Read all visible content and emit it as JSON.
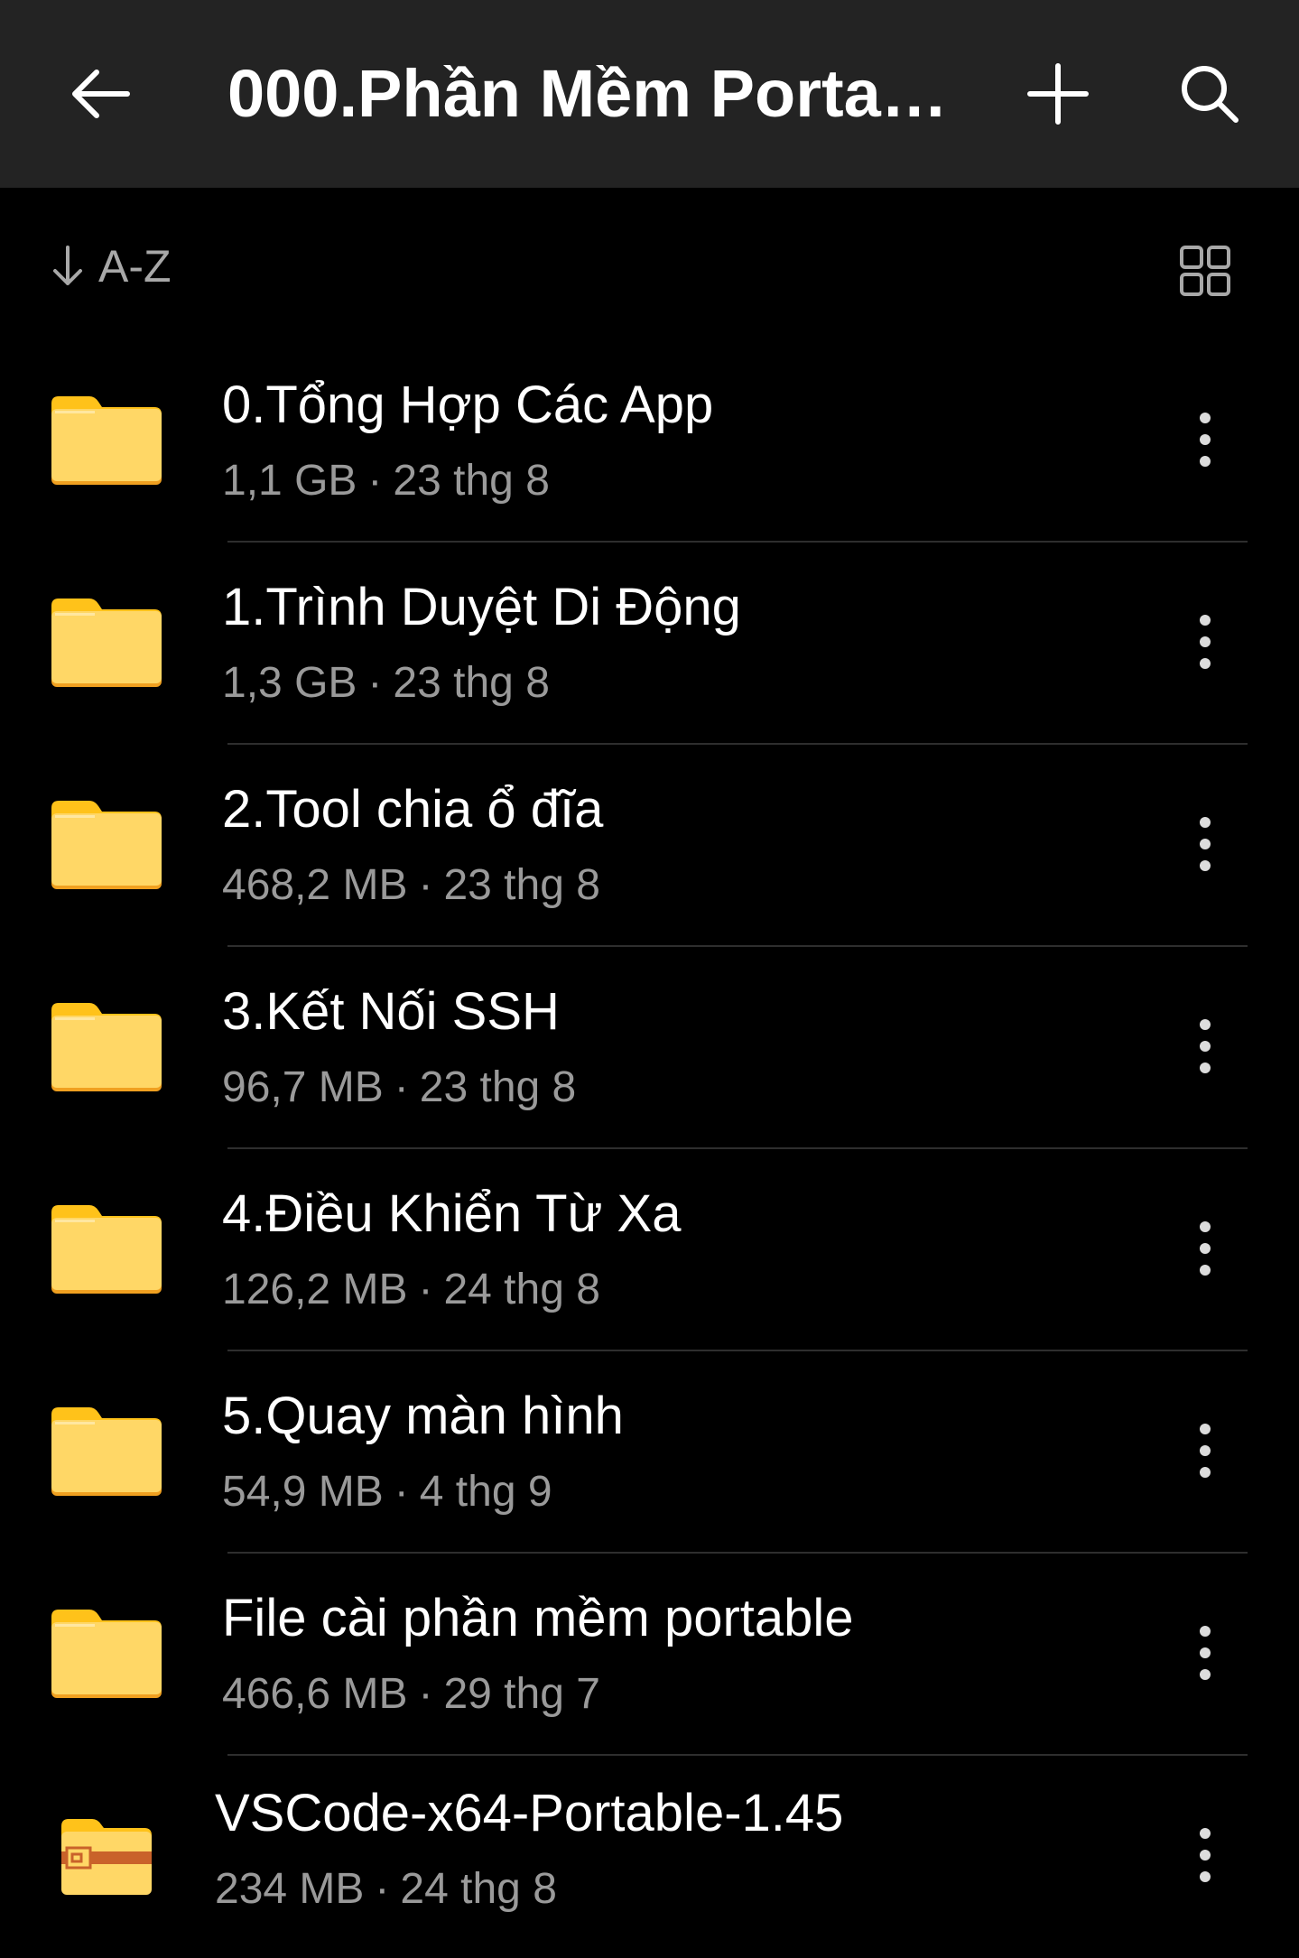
{
  "appbar": {
    "title": "000.Phần Mềm Porta…",
    "back_icon": "arrow-left-icon",
    "add_icon": "plus-icon",
    "search_icon": "search-icon"
  },
  "sortbar": {
    "label": "A-Z",
    "sort_icon": "arrow-down-icon",
    "view_icon": "grid-view-icon"
  },
  "colors": {
    "appbar_bg": "#232323",
    "background": "#000000",
    "folder_yellow": "#FFD766",
    "folder_tab": "#FFC21A",
    "folder_edge": "#F0A020",
    "archive_stripe": "#C9622A",
    "secondary_text": "#9A9A9A"
  },
  "items": [
    {
      "name": "0.Tổng Hợp Các App",
      "size": "1,1 GB",
      "date": "23 thg 8",
      "separator": "·",
      "icon": "folder-icon"
    },
    {
      "name": "1.Trình Duyệt Di Động",
      "size": "1,3 GB",
      "date": "23 thg 8",
      "separator": "·",
      "icon": "folder-icon"
    },
    {
      "name": "2.Tool chia ổ đĩa",
      "size": "468,2 MB",
      "date": "23 thg 8",
      "separator": "·",
      "icon": "folder-icon"
    },
    {
      "name": "3.Kết Nối SSH",
      "size": "96,7 MB",
      "date": "23 thg 8",
      "separator": "·",
      "icon": "folder-icon"
    },
    {
      "name": "4.Điều Khiển Từ Xa",
      "size": "126,2 MB",
      "date": "24 thg 8",
      "separator": "·",
      "icon": "folder-icon"
    },
    {
      "name": "5.Quay màn hình",
      "size": "54,9 MB",
      "date": "4 thg 9",
      "separator": "·",
      "icon": "folder-icon"
    },
    {
      "name": "File cài phần mềm portable",
      "size": "466,6 MB",
      "date": "29 thg 7",
      "separator": "·",
      "icon": "folder-icon"
    },
    {
      "name": "VSCode-x64-Portable-1.45",
      "size": "234 MB",
      "date": "24 thg 8",
      "separator": "·",
      "icon": "archive-icon"
    }
  ]
}
